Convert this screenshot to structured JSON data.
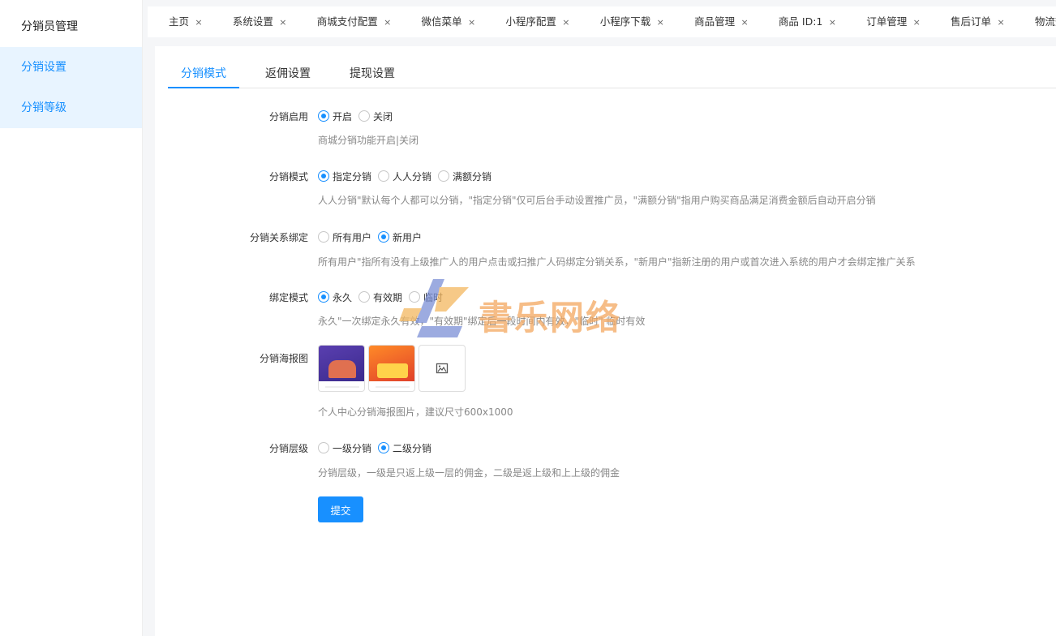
{
  "sidebar": {
    "header": "分销员管理",
    "items": [
      {
        "label": "分销设置"
      },
      {
        "label": "分销等级"
      }
    ]
  },
  "tabs": [
    {
      "label": "主页"
    },
    {
      "label": "系统设置"
    },
    {
      "label": "商城支付配置"
    },
    {
      "label": "微信菜单"
    },
    {
      "label": "小程序配置"
    },
    {
      "label": "小程序下载"
    },
    {
      "label": "商品管理"
    },
    {
      "label": "商品 ID:1"
    },
    {
      "label": "订单管理"
    },
    {
      "label": "售后订单"
    },
    {
      "label": "物流查询配"
    }
  ],
  "tab_close_symbol": "×",
  "subtabs": [
    {
      "label": "分销模式",
      "active": true
    },
    {
      "label": "返佣设置",
      "active": false
    },
    {
      "label": "提现设置",
      "active": false
    }
  ],
  "form": {
    "enable": {
      "label": "分销启用",
      "options": [
        {
          "label": "开启",
          "selected": true
        },
        {
          "label": "关闭",
          "selected": false
        }
      ],
      "help": "商城分销功能开启|关闭"
    },
    "mode": {
      "label": "分销模式",
      "options": [
        {
          "label": "指定分销",
          "selected": true
        },
        {
          "label": "人人分销",
          "selected": false
        },
        {
          "label": "满额分销",
          "selected": false
        }
      ],
      "help": "人人分销\"默认每个人都可以分销，\"指定分销\"仅可后台手动设置推广员，\"满额分销\"指用户购买商品满足消费金额后自动开启分销"
    },
    "binding": {
      "label": "分销关系绑定",
      "options": [
        {
          "label": "所有用户",
          "selected": false
        },
        {
          "label": "新用户",
          "selected": true
        }
      ],
      "help": "所有用户\"指所有没有上级推广人的用户点击或扫推广人码绑定分销关系，\"新用户\"指新注册的用户或首次进入系统的用户才会绑定推广关系"
    },
    "bind_mode": {
      "label": "绑定模式",
      "options": [
        {
          "label": "永久",
          "selected": true
        },
        {
          "label": "有效期",
          "selected": false
        },
        {
          "label": "临时",
          "selected": false
        }
      ],
      "help": "永久\"一次绑定永久有效，\"有效期\"绑定后一段时间内有效，\"临时\" 临时有效"
    },
    "poster": {
      "label": "分销海报图",
      "help": "个人中心分销海报图片，建议尺寸600x1000"
    },
    "level": {
      "label": "分销层级",
      "options": [
        {
          "label": "一级分销",
          "selected": false
        },
        {
          "label": "二级分销",
          "selected": true
        }
      ],
      "help": "分销层级，一级是只返上级一层的佣金，二级是返上级和上上级的佣金"
    },
    "submit_label": "提交"
  },
  "watermark": {
    "text": "書乐网络"
  },
  "colors": {
    "primary": "#1890ff",
    "sidebar_active_bg": "#e8f4ff",
    "watermark": "#f4a860"
  }
}
